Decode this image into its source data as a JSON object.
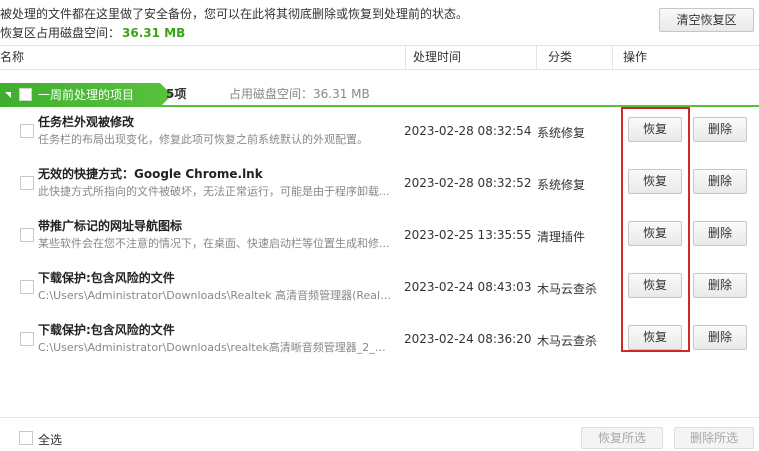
{
  "info": {
    "line1": "被处理的文件都在这里做了安全备份，您可以在此将其彻底删除或恢复到处理前的状态。",
    "line2_label": "恢复区占用磁盘空间：",
    "line2_size": "36.31 MB"
  },
  "toolbar": {
    "clear_label": "清空恢复区"
  },
  "columns": {
    "name": "名称",
    "time": "处理时间",
    "category": "分类",
    "action": "操作"
  },
  "group": {
    "label": "一周前处理的项目",
    "count": "5项",
    "size_text": "占用磁盘空间：36.31 MB"
  },
  "rows": [
    {
      "title": "任务栏外观被修改",
      "desc": "任务栏的布局出现变化，修复此项可恢复之前系统默认的外观配置。",
      "time": "2023-02-28 08:32:54",
      "category": "系统修复",
      "restore": "恢复",
      "delete": "删除"
    },
    {
      "title": "无效的快捷方式：Google Chrome.lnk",
      "desc": "此快捷方式所指向的文件被破坏，无法正常运行，可能是由于程序卸载...",
      "time": "2023-02-28 08:32:52",
      "category": "系统修复",
      "restore": "恢复",
      "delete": "删除"
    },
    {
      "title": "带推广标记的网址导航图标",
      "desc": "某些软件会在您不注意的情况下，在桌面、快速启动栏等位置生成和修...",
      "time": "2023-02-25 13:35:55",
      "category": "清理插件",
      "restore": "恢复",
      "delete": "删除"
    },
    {
      "title": "下载保护:包含风险的文件",
      "desc": "C:\\Users\\Administrator\\Downloads\\Realtek 高清音频管理器(Realte...",
      "time": "2023-02-24 08:43:03",
      "category": "木马云查杀",
      "restore": "恢复",
      "delete": "删除"
    },
    {
      "title": "下载保护:包含风险的文件",
      "desc": "C:\\Users\\Administrator\\Downloads\\realtek高清晰音频管理器_2_12...",
      "time": "2023-02-24 08:36:20",
      "category": "木马云查杀",
      "restore": "恢复",
      "delete": "删除"
    }
  ],
  "footer": {
    "select_all": "全选",
    "restore_selected": "恢复所选",
    "delete_selected": "删除所选"
  }
}
